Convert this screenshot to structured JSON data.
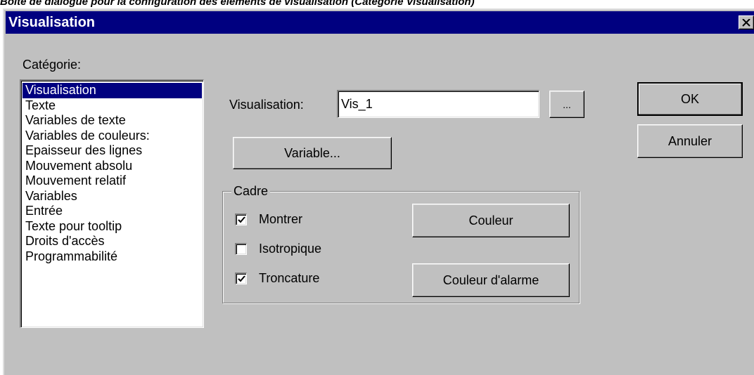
{
  "caption": "Boîte de dialogue pour la configuration des éléments de visualisation (Catégorie Visualisation)",
  "dialog": {
    "title": "Visualisation",
    "close_icon": "close-icon"
  },
  "category": {
    "label": "Catégorie:",
    "items": [
      "Visualisation",
      "Texte",
      "Variables de texte",
      "Variables de couleurs:",
      "Epaisseur des lignes",
      "Mouvement absolu",
      "Mouvement relatif",
      "Variables",
      "Entrée",
      "Texte pour tooltip",
      "Droits d'accès",
      "Programmabilité"
    ],
    "selected": "Visualisation"
  },
  "visualisation": {
    "label": "Visualisation:",
    "value": "Vis_1",
    "browse_label": "...",
    "variable_button": "Variable..."
  },
  "cadre": {
    "legend": "Cadre",
    "show_label": "Montrer",
    "show_checked": true,
    "isotropic_label": "Isotropique",
    "isotropic_checked": false,
    "clip_label": "Troncature",
    "clip_checked": true,
    "color_button": "Couleur",
    "alarm_color_button": "Couleur d'alarme"
  },
  "actions": {
    "ok_label": "OK",
    "cancel_label": "Annuler"
  },
  "colors": {
    "titlebar": "#000080",
    "face": "#c0c0c0",
    "selection": "#000080"
  }
}
